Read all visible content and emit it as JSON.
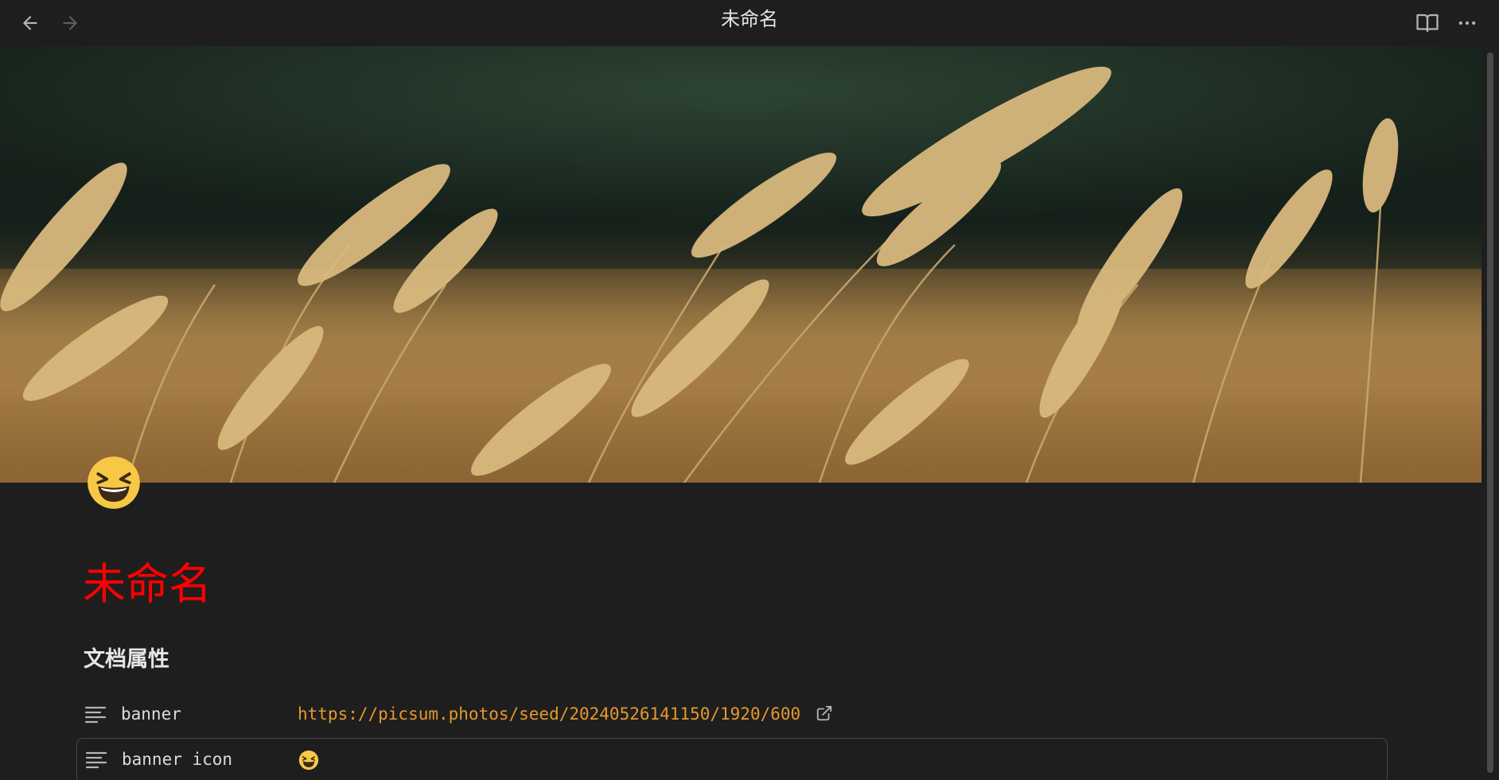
{
  "window": {
    "title": "未命名"
  },
  "toolbar": {
    "back_icon": "arrow-left-icon",
    "forward_icon": "arrow-right-icon",
    "reading_mode_icon": "book-open-icon",
    "more_icon": "more-horizontal-icon"
  },
  "banner": {
    "image_subject": "wheat field"
  },
  "document": {
    "title": "未命名",
    "title_color": "#ff0000",
    "icon": "laughing-face-emoji"
  },
  "properties": {
    "heading": "文档属性",
    "items": [
      {
        "key": "banner",
        "value": "https://picsum.photos/seed/20240526141150/1920/600",
        "type": "link"
      },
      {
        "key": "banner icon",
        "value": "😆",
        "type": "emoji"
      }
    ]
  },
  "colors": {
    "background": "#1e1e1e",
    "link": "#e5982b",
    "title": "#ff0000"
  }
}
